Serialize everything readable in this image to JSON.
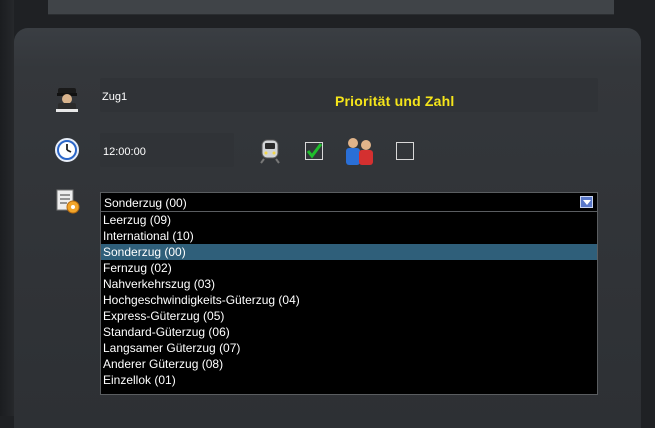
{
  "train": {
    "name": "Zug1",
    "time": "12:00:00"
  },
  "title": "Priorität und Zahl",
  "checkboxes": {
    "train_checked": true,
    "passengers_checked": false
  },
  "category": {
    "selected": "Sonderzug (00)",
    "options": [
      "Leerzug  (09)",
      "International (10)",
      "Sonderzug (00)",
      "Fernzug (02)",
      "Nahverkehrszug (03)",
      "Hochgeschwindigkeits-Güterzug (04)",
      "Express-Güterzug (05)",
      "Standard-Güterzug (06)",
      "Langsamer Güterzug (07)",
      "Anderer Güterzug (08)",
      "Einzellok (01)"
    ],
    "highlighted_index": 2
  },
  "icons": {
    "driver": "train-driver-icon",
    "clock": "clock-icon",
    "train": "train-front-icon",
    "passengers": "passengers-icon",
    "category": "list-settings-icon"
  },
  "colors": {
    "title": "#f5e51a",
    "highlight": "#2f5f7a",
    "check": "#1fbe2c"
  }
}
